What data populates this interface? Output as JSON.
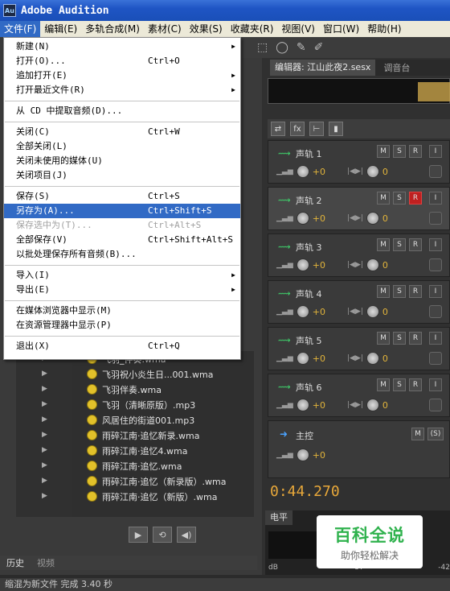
{
  "window": {
    "title": "Adobe Audition",
    "icon": "Au"
  },
  "menubar": [
    {
      "label": "文件(F)",
      "active": true
    },
    {
      "label": "编辑(E)"
    },
    {
      "label": "多轨合成(M)"
    },
    {
      "label": "素材(C)"
    },
    {
      "label": "效果(S)"
    },
    {
      "label": "收藏夹(R)"
    },
    {
      "label": "视图(V)"
    },
    {
      "label": "窗口(W)"
    },
    {
      "label": "帮助(H)"
    }
  ],
  "file_menu": {
    "items": [
      {
        "label": "新建(N)",
        "submenu": true
      },
      {
        "label": "打开(O)...",
        "shortcut": "Ctrl+O"
      },
      {
        "label": "追加打开(E)",
        "submenu": true
      },
      {
        "label": "打开最近文件(R)",
        "submenu": true
      },
      {
        "separator": true
      },
      {
        "label": "从 CD 中提取音频(D)..."
      },
      {
        "separator": true
      },
      {
        "label": "关闭(C)",
        "shortcut": "Ctrl+W"
      },
      {
        "label": "全部关闭(L)"
      },
      {
        "label": "关闭未使用的媒体(U)"
      },
      {
        "label": "关闭项目(J)"
      },
      {
        "separator": true
      },
      {
        "label": "保存(S)",
        "shortcut": "Ctrl+S"
      },
      {
        "label": "另存为(A)...",
        "shortcut": "Ctrl+Shift+S",
        "highlighted": true
      },
      {
        "label": "保存选中为(T)...",
        "shortcut": "Ctrl+Alt+S",
        "disabled": true
      },
      {
        "label": "全部保存(V)",
        "shortcut": "Ctrl+Shift+Alt+S"
      },
      {
        "label": "以批处理保存所有音频(B)..."
      },
      {
        "separator": true
      },
      {
        "label": "导入(I)",
        "submenu": true
      },
      {
        "label": "导出(E)",
        "submenu": true
      },
      {
        "separator": true
      },
      {
        "label": "在媒体浏览器中显示(M)"
      },
      {
        "label": "在资源管理器中显示(P)"
      },
      {
        "separator": true
      },
      {
        "label": "退出(X)",
        "shortcut": "Ctrl+Q"
      }
    ]
  },
  "editor": {
    "tab_label": "编辑器: 江山此夜2.sesx",
    "mixer_label": "调音台"
  },
  "tracks": [
    {
      "name": "声轨 1",
      "vol": "+0",
      "pan": "0",
      "record": false,
      "selected": false
    },
    {
      "name": "声轨 2",
      "vol": "+0",
      "pan": "0",
      "record": true,
      "selected": true
    },
    {
      "name": "声轨 3",
      "vol": "+0",
      "pan": "0",
      "record": false,
      "selected": false
    },
    {
      "name": "声轨 4",
      "vol": "+0",
      "pan": "0",
      "record": false,
      "selected": false
    },
    {
      "name": "声轨 5",
      "vol": "+0",
      "pan": "0",
      "record": false,
      "selected": false
    },
    {
      "name": "声轨 6",
      "vol": "+0",
      "pan": "0",
      "record": false,
      "selected": false
    }
  ],
  "track_buttons": {
    "m": "M",
    "s": "S",
    "r": "R",
    "i": "I"
  },
  "master": {
    "name": "主控",
    "vol": "+0",
    "m": "M",
    "s": "(S)"
  },
  "timecode": "0:44.270",
  "level_panel": {
    "tab": "电平",
    "scale": [
      "dB",
      "-57",
      "-42"
    ]
  },
  "files": [
    "飞羽_伴奏.wma",
    "飞羽祝小炎生日...001.wma",
    "飞羽伴奏.wma",
    "飞羽（清晰原版）.mp3",
    "风居住的街道001.mp3",
    "雨碎江南·追忆新录.wma",
    "雨碎江南·追忆4.wma",
    "雨碎江南·追忆.wma",
    "雨碎江南·追忆（新录版）.wma",
    "雨碎江南·追忆（新版）.wma"
  ],
  "history_tabs": [
    "历史",
    "视频"
  ],
  "status": "缩混为新文件 完成 3.40 秒",
  "watermark": {
    "title": "百科全说",
    "subtitle": "助你轻松解决"
  }
}
